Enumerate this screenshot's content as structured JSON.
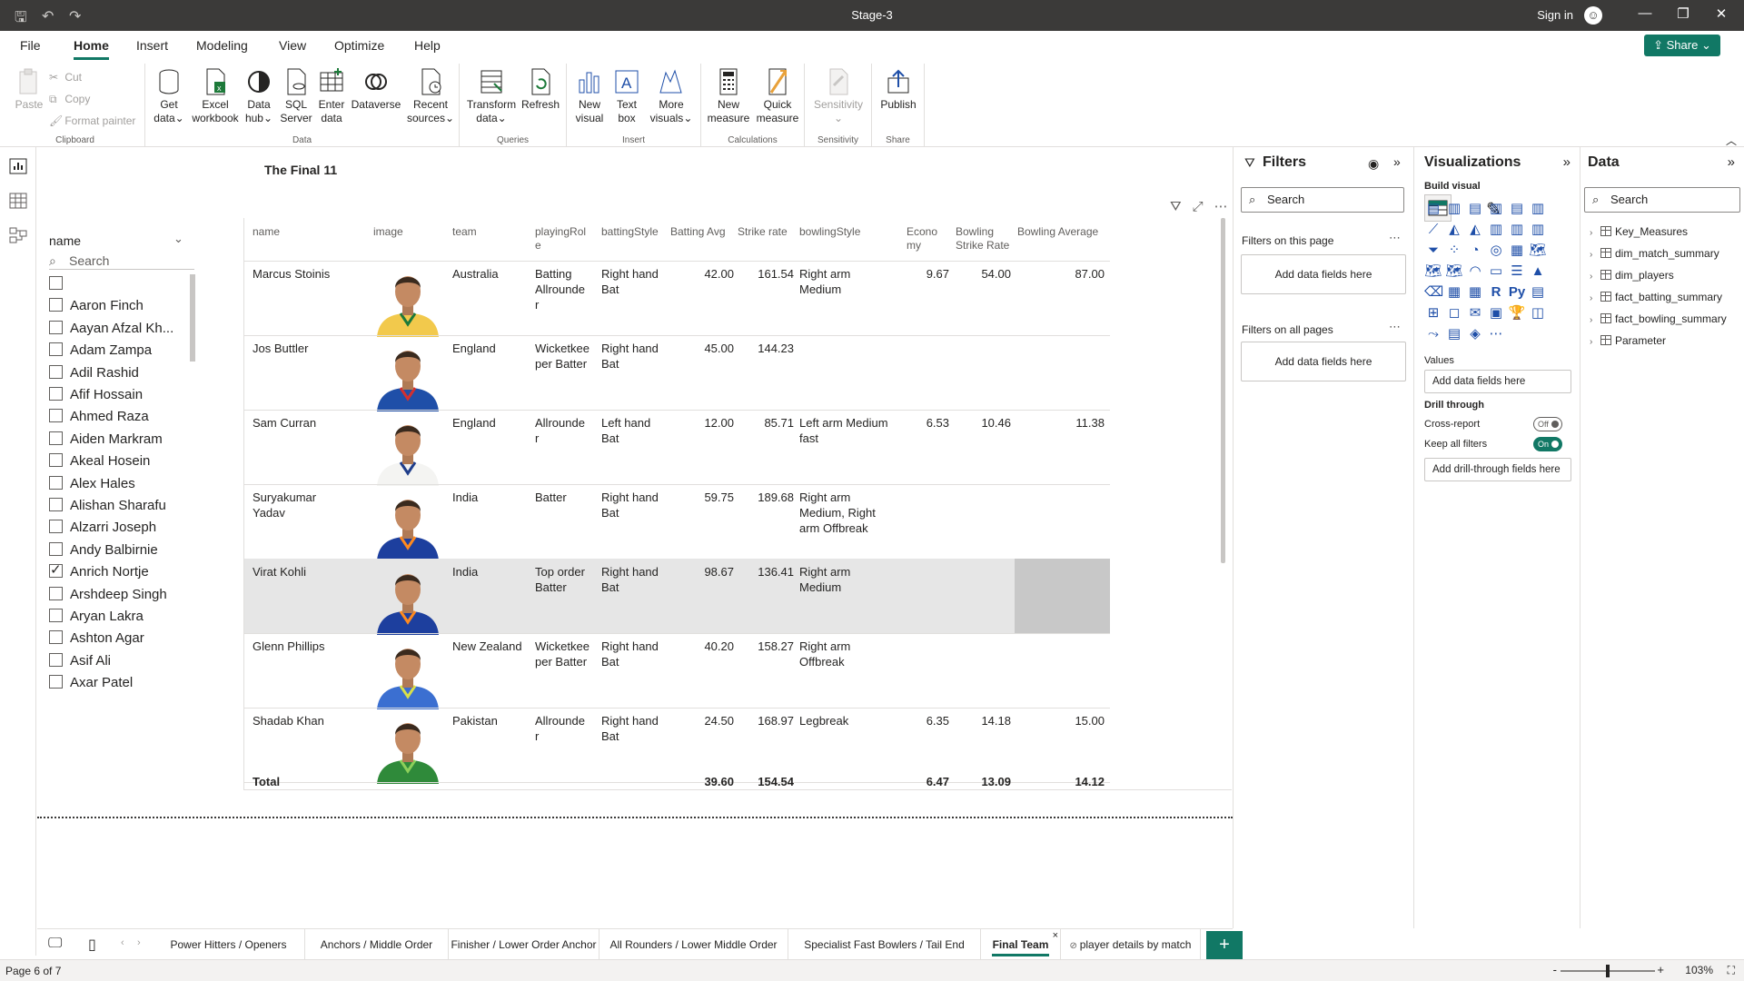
{
  "window": {
    "title": "Stage-3",
    "sign_in": "Sign in"
  },
  "menu": {
    "tabs": [
      "File",
      "Home",
      "Insert",
      "Modeling",
      "View",
      "Optimize",
      "Help"
    ],
    "active": "Home",
    "share": "Share"
  },
  "ribbon": {
    "clipboard": {
      "paste": "Paste",
      "cut": "Cut",
      "copy": "Copy",
      "format_painter": "Format painter",
      "label": "Clipboard"
    },
    "data": {
      "get_data": [
        "Get",
        "data"
      ],
      "excel": [
        "Excel",
        "workbook"
      ],
      "hub": [
        "Data",
        "hub"
      ],
      "sql": [
        "SQL",
        "Server"
      ],
      "enter": [
        "Enter",
        "data"
      ],
      "dataverse": "Dataverse",
      "recent": [
        "Recent",
        "sources"
      ],
      "label": "Data"
    },
    "queries": {
      "transform": [
        "Transform",
        "data"
      ],
      "refresh": "Refresh",
      "label": "Queries"
    },
    "insert": {
      "new_visual": [
        "New",
        "visual"
      ],
      "text_box": [
        "Text",
        "box"
      ],
      "more_visuals": [
        "More",
        "visuals"
      ],
      "label": "Insert"
    },
    "calculations": {
      "new_measure": [
        "New",
        "measure"
      ],
      "quick_measure": [
        "Quick",
        "measure"
      ],
      "label": "Calculations"
    },
    "sensitivity": {
      "btn": "Sensitivity",
      "label": "Sensitivity"
    },
    "share": {
      "publish": "Publish",
      "label": "Share"
    }
  },
  "canvas": {
    "visual_title": "The Final 11",
    "slicer": {
      "header": "name",
      "search_placeholder": "Search",
      "items": [
        {
          "label": "",
          "checked": false
        },
        {
          "label": "Aaron Finch",
          "checked": false
        },
        {
          "label": "Aayan Afzal Kh...",
          "checked": false
        },
        {
          "label": "Adam Zampa",
          "checked": false
        },
        {
          "label": "Adil Rashid",
          "checked": false
        },
        {
          "label": "Afif Hossain",
          "checked": false
        },
        {
          "label": "Ahmed Raza",
          "checked": false
        },
        {
          "label": "Aiden Markram",
          "checked": false
        },
        {
          "label": "Akeal Hosein",
          "checked": false
        },
        {
          "label": "Alex Hales",
          "checked": false
        },
        {
          "label": "Alishan Sharafu",
          "checked": false
        },
        {
          "label": "Alzarri Joseph",
          "checked": false
        },
        {
          "label": "Andy Balbirnie",
          "checked": false
        },
        {
          "label": "Anrich Nortje",
          "checked": true
        },
        {
          "label": "Arshdeep Singh",
          "checked": false
        },
        {
          "label": "Aryan Lakra",
          "checked": false
        },
        {
          "label": "Ashton Agar",
          "checked": false
        },
        {
          "label": "Asif Ali",
          "checked": false
        },
        {
          "label": "Axar Patel",
          "checked": false
        }
      ]
    },
    "table": {
      "headers": {
        "name": "name",
        "image": "image",
        "team": "team",
        "role": [
          "playingRol",
          "e"
        ],
        "bat": "battingStyle",
        "avg": "Batting Avg",
        "sr": "Strike rate",
        "bowl": "bowlingStyle",
        "econ": [
          "Econo",
          "my"
        ],
        "bsr": [
          "Bowling",
          "Strike Rate"
        ],
        "bavg": "Bowling Average"
      },
      "rows": [
        {
          "name": "Marcus Stoinis",
          "team": "Australia",
          "role": [
            "Batting",
            "Allrounde",
            "r"
          ],
          "bat": [
            "Right hand",
            "Bat"
          ],
          "avg": "42.00",
          "sr": "161.54",
          "bowl": [
            "Right arm",
            "Medium"
          ],
          "econ": "9.67",
          "bsr": "54.00",
          "bavg": "87.00",
          "kit": "#f2c94c",
          "trim": "#1d7a3a"
        },
        {
          "name": "Jos Buttler",
          "team": "England",
          "role": [
            "Wicketkee",
            "per Batter"
          ],
          "bat": [
            "Right hand",
            "Bat"
          ],
          "avg": "45.00",
          "sr": "144.23",
          "bowl": [],
          "econ": "",
          "bsr": "",
          "bavg": "",
          "kit": "#1f4fa8",
          "trim": "#d23030"
        },
        {
          "name": "Sam Curran",
          "team": "England",
          "role": [
            "Allrounde",
            "r"
          ],
          "bat": [
            "Left hand",
            "Bat"
          ],
          "avg": "12.00",
          "sr": "85.71",
          "bowl": [
            "Left arm Medium",
            "fast"
          ],
          "econ": "6.53",
          "bsr": "10.46",
          "bavg": "11.38",
          "kit": "#f4f4f2",
          "trim": "#1f3d8a"
        },
        {
          "name": "Suryakumar Yadav",
          "team": "India",
          "role": [
            "Batter"
          ],
          "bat": [
            "Right hand",
            "Bat"
          ],
          "avg": "59.75",
          "sr": "189.68",
          "bowl": [
            "Right arm",
            "Medium, Right",
            "arm Offbreak"
          ],
          "econ": "",
          "bsr": "",
          "bavg": "",
          "kit": "#1d3f9e",
          "trim": "#ff8a1f"
        },
        {
          "name": "Virat Kohli",
          "team": "India",
          "role": [
            "Top order",
            "Batter"
          ],
          "bat": [
            "Right hand",
            "Bat"
          ],
          "avg": "98.67",
          "sr": "136.41",
          "bowl": [
            "Right arm",
            "Medium"
          ],
          "econ": "",
          "bsr": "",
          "bavg": "",
          "kit": "#1d3f9e",
          "trim": "#ff8a1f"
        },
        {
          "name": "Glenn Phillips",
          "team": "New Zealand",
          "role": [
            "Wicketkee",
            "per Batter"
          ],
          "bat": [
            "Right hand",
            "Bat"
          ],
          "avg": "40.20",
          "sr": "158.27",
          "bowl": [
            "Right arm",
            "Offbreak"
          ],
          "econ": "",
          "bsr": "",
          "bavg": "",
          "kit": "#3b6fd1",
          "trim": "#d8e04a"
        },
        {
          "name": "Shadab Khan",
          "team": "Pakistan",
          "role": [
            "Allrounde",
            "r"
          ],
          "bat": [
            "Right hand",
            "Bat"
          ],
          "avg": "24.50",
          "sr": "168.97",
          "bowl": [
            "Legbreak"
          ],
          "econ": "6.35",
          "bsr": "14.18",
          "bavg": "15.00",
          "kit": "#2f8a3a",
          "trim": "#8cd05a"
        }
      ],
      "total": {
        "label": "Total",
        "avg": "39.60",
        "sr": "154.54",
        "econ": "6.47",
        "bsr": "13.09",
        "bavg": "14.12"
      },
      "highlighted_row": 4
    }
  },
  "filters": {
    "title": "Filters",
    "search": "Search",
    "on_page": "Filters on this page",
    "all_pages": "Filters on all pages",
    "add_fields": "Add data fields here"
  },
  "viz": {
    "title": "Visualizations",
    "build": "Build visual",
    "values": "Values",
    "values_add": "Add data fields here",
    "drill": "Drill through",
    "cross_report": "Cross-report",
    "cross_state": "Off",
    "keep_filters": "Keep all filters",
    "keep_state": "On",
    "drill_add": "Add drill-through fields here"
  },
  "data_pane": {
    "title": "Data",
    "search": "Search",
    "tables": [
      "Key_Measures",
      "dim_match_summary",
      "dim_players",
      "fact_batting_summary",
      "fact_bowling_summary",
      "Parameter"
    ]
  },
  "pages": {
    "tabs": [
      "Power Hitters / Openers",
      "Anchors / Middle Order",
      "Finisher / Lower Order Anchor",
      "All Rounders / Lower Middle Order",
      "Specialist Fast Bowlers / Tail End",
      "Final Team",
      "player details by match"
    ],
    "active": "Final Team",
    "status": "Page 6 of 7",
    "zoom": "103%"
  },
  "colors": {
    "accent": "#117865",
    "titlebar": "#3b3a39",
    "highlight": "#e6e6e6"
  }
}
